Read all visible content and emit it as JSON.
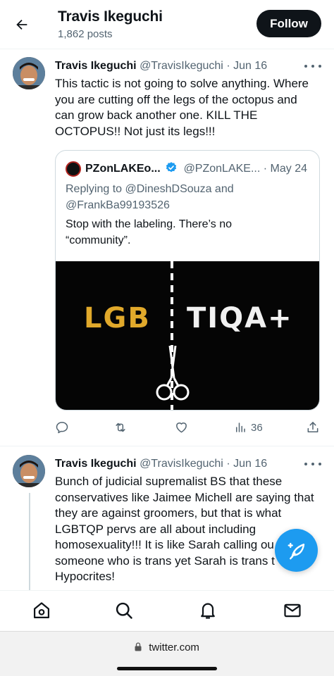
{
  "header": {
    "title": "Travis Ikeguchi",
    "post_count": "1,862 posts",
    "follow_label": "Follow"
  },
  "tweets": [
    {
      "name": "Travis Ikeguchi",
      "handle": "@TravisIkeguchi",
      "sep": "·",
      "date": "Jun 16",
      "lines": [
        "This tactic is not going to solve anything. Where",
        "you are cutting off the legs of the octopus and",
        "can grow back another one. KILL THE",
        "OCTOPUS!! Not just its legs!!!"
      ],
      "quoted": {
        "name": "PZonLAKEo...",
        "handle": "@PZonLAKE...",
        "sep": "·",
        "date": "May 24",
        "replying_prefix": "Replying to",
        "replying_to_1": "@DineshDSouza",
        "replying_and": "and",
        "replying_to_2": "@FrankBa99193526",
        "text_line_1": "Stop with the labeling. There’s no",
        "text_line_2": "“community”.",
        "image_text_left": "LGB",
        "image_text_right": "TIQA+"
      },
      "actions": {
        "views": "36"
      }
    },
    {
      "name": "Travis Ikeguchi",
      "handle": "@TravisIkeguchi",
      "sep": "·",
      "date": "Jun 16",
      "lines": [
        "Bunch of judicial supremalist BS that these",
        "conservatives like Jaimee Michell are saying that",
        "they are against groomers, but that is what",
        "LGBTQP pervs are all about including",
        "homosexuality!!! It is like Sarah calling ou",
        "someone who is trans yet Sarah is trans t",
        "Hypocrites!"
      ]
    }
  ],
  "browser": {
    "url": "twitter.com"
  },
  "colors": {
    "accent": "#1d9bf0",
    "text": "#0f1419",
    "muted": "#536471",
    "lgb_yellow": "#e1a92b"
  }
}
